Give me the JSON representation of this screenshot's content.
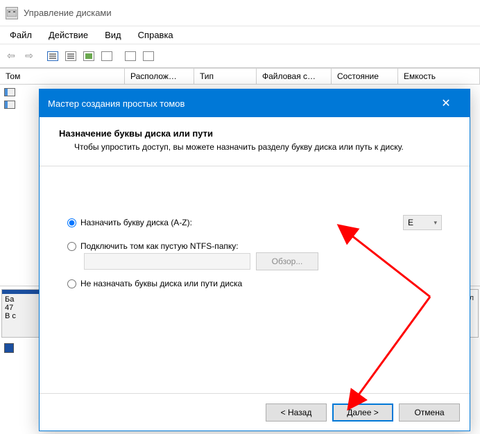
{
  "app": {
    "title": "Управление дисками"
  },
  "menubar": {
    "file": "Файл",
    "action": "Действие",
    "view": "Вид",
    "help": "Справка"
  },
  "columns": {
    "volume": "Том",
    "layout": "Располож…",
    "type": "Тип",
    "fs": "Файловая с…",
    "status": "Состояние",
    "capacity": "Емкость"
  },
  "disk_panel": {
    "label_prefix": "Ба",
    "size_line": "47",
    "status_line": "В с",
    "right_tag": "здел"
  },
  "wizard": {
    "title": "Мастер создания простых томов",
    "heading": "Назначение буквы диска или пути",
    "subheading": "Чтобы упростить доступ, вы можете назначить разделу букву диска или путь к диску.",
    "opt_assign": "Назначить букву диска (A-Z):",
    "opt_mount": "Подключить том как пустую NTFS-папку:",
    "opt_none": "Не назначать буквы диска или пути диска",
    "selected_letter": "E",
    "browse": "Обзор...",
    "back": "< Назад",
    "next": "Далее >",
    "cancel": "Отмена"
  }
}
